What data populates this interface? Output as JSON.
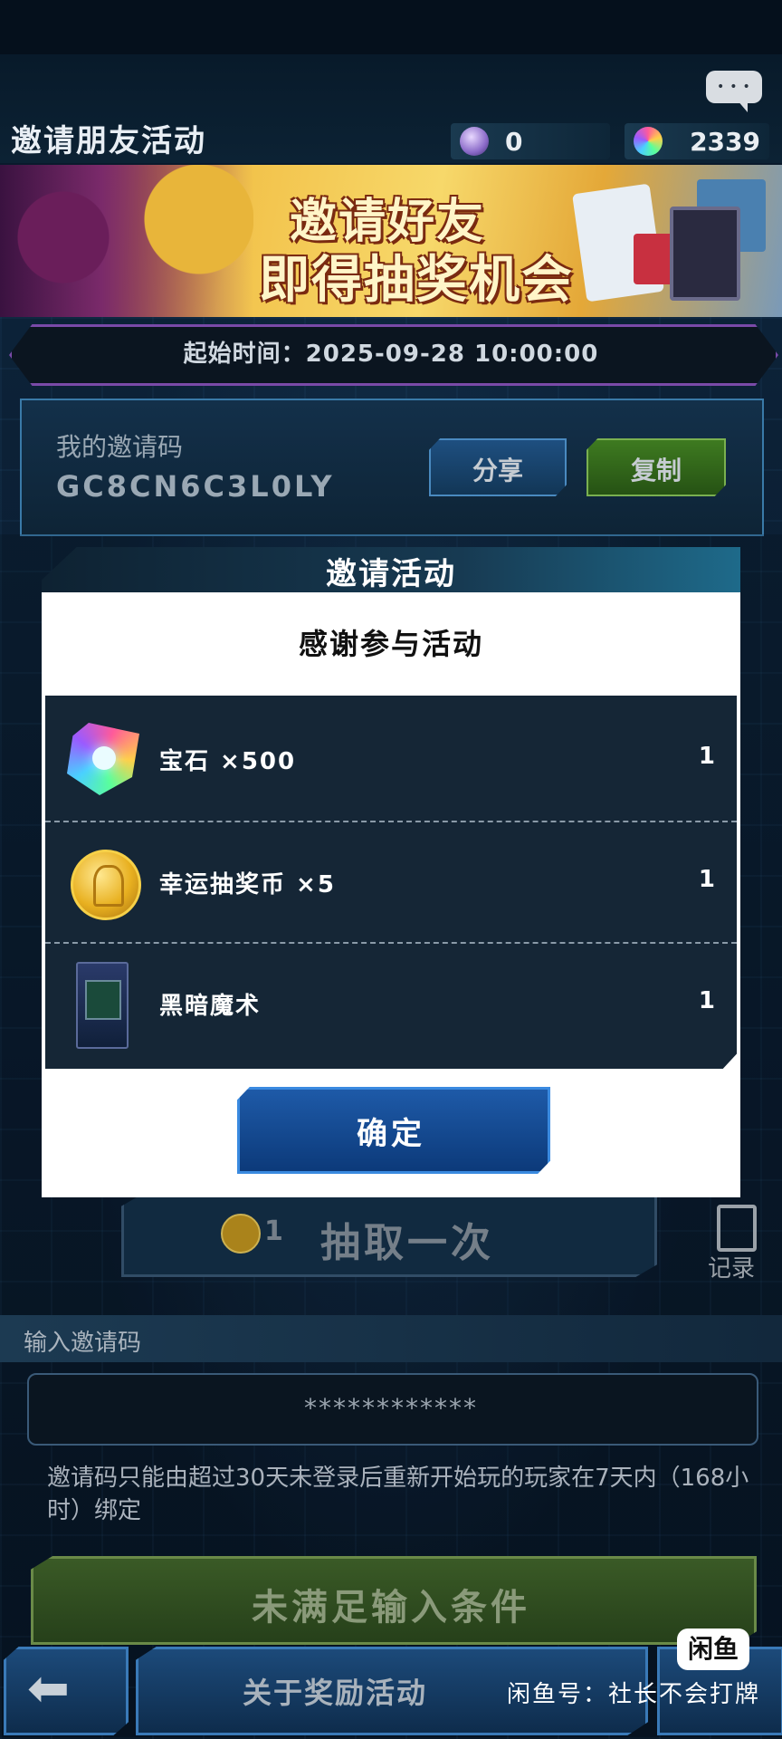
{
  "header": {
    "title": "邀请朋友活动",
    "currency1_value": "0",
    "currency2_value": "2339",
    "chat_icon": "chat-bubble-icon"
  },
  "banner": {
    "line1": "邀请好友",
    "line2": "即得抽奖机会"
  },
  "start_time": "起始时间：2025-09-28 10:00:00",
  "invite": {
    "label": "我的邀请码",
    "code": "GC8CN6C3L0LY",
    "share_label": "分享",
    "copy_label": "复制"
  },
  "draw": {
    "count": "1",
    "label": "抽取一次",
    "record_label": "记录"
  },
  "modal": {
    "title": "邀请活动",
    "subtitle": "感谢参与活动",
    "rewards": [
      {
        "name": "宝石 ×500",
        "qty": "1",
        "icon": "gem-icon"
      },
      {
        "name": "幸运抽奖币 ×5",
        "qty": "1",
        "icon": "lucky-coin-icon"
      },
      {
        "name": "黑暗魔术",
        "qty": "1",
        "icon": "card-pack-icon"
      }
    ],
    "confirm_label": "确定"
  },
  "input_section": {
    "header": "输入邀请码",
    "value": "************",
    "note": "邀请码只能由超过30天未登录后重新开始玩的玩家在7天内（168小时）绑定",
    "condition_label": "未满足输入条件"
  },
  "footer": {
    "back_icon": "back-arrow-icon",
    "about_label": "关于奖励活动"
  },
  "watermark": {
    "logo": "闲鱼",
    "text": "闲鱼号：社长不会打牌"
  },
  "colors": {
    "background": "#0a1a2c",
    "accent_blue": "#1e5aa8",
    "accent_green": "#3e7a20",
    "timebar_border": "#7a4aa8"
  }
}
